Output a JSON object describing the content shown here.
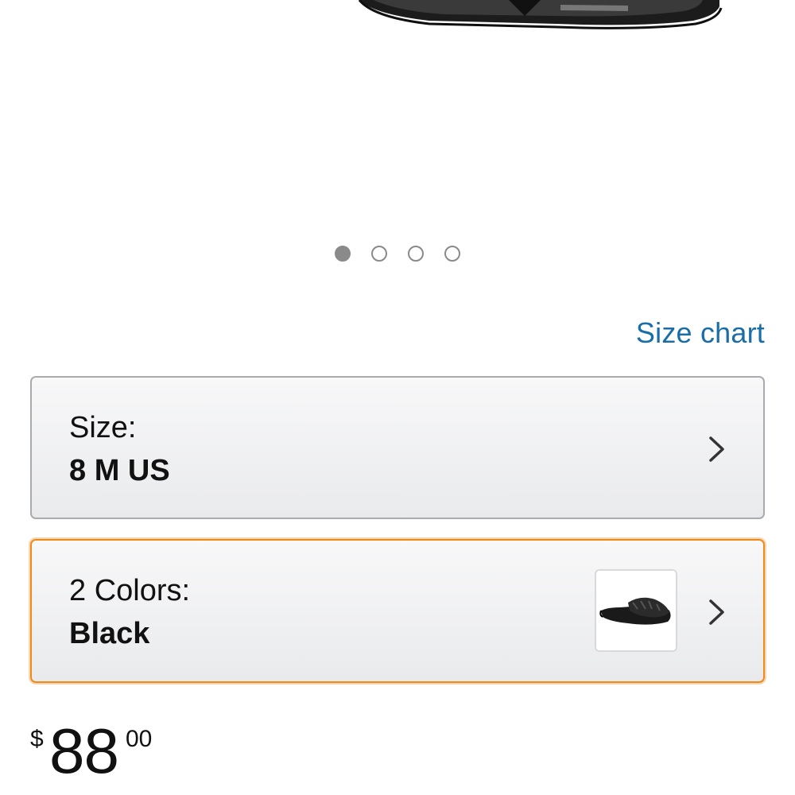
{
  "carousel": {
    "total_images": 4,
    "active_index": 0
  },
  "size_chart_link": "Size chart",
  "size_selector": {
    "label": "Size:",
    "value": "8 M US"
  },
  "color_selector": {
    "label": "2 Colors:",
    "value": "Black"
  },
  "price": {
    "currency": "$",
    "whole": "88",
    "fraction": "00"
  },
  "colors": {
    "link": "#1a6ea8",
    "selected_border": "#ef8a1c",
    "box_border": "#a9abae",
    "dot": "#8a8a8a"
  },
  "icons": {
    "chevron": "chevron-right-icon"
  }
}
